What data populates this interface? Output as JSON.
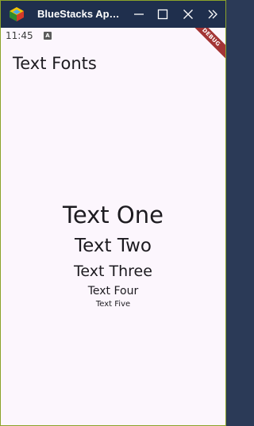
{
  "window": {
    "title": "BlueStacks Ap…",
    "app_icon": "bluestacks-logo",
    "controls": {
      "minimize_icon": "minimize-icon",
      "maximize_icon": "maximize-icon",
      "close_icon": "close-icon",
      "more_icon": "chevrons-right-icon"
    },
    "titlebar_color": "#1f2f4d",
    "frame_color": "#8ba32a"
  },
  "status_bar": {
    "time": "11:45",
    "notification_badge": "A"
  },
  "debug_banner": {
    "label": "DEBUG",
    "color": "#a33535"
  },
  "app_bar": {
    "title": "Text Fonts"
  },
  "body_texts": [
    "Text One",
    "Text Two",
    "Text Three",
    "Text Four",
    "Text Five"
  ],
  "colors": {
    "background": "#fcf6fd",
    "text": "#1d1b20"
  }
}
